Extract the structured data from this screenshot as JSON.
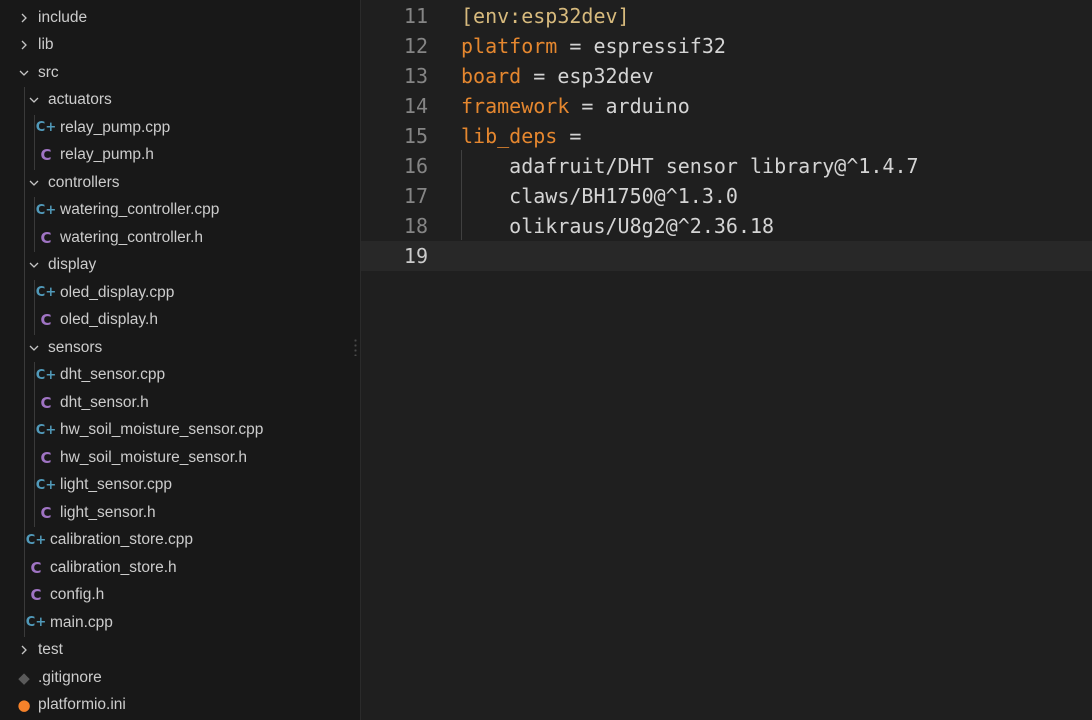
{
  "explorer": {
    "items": [
      {
        "name": "include",
        "kind": "folder",
        "expanded": false,
        "depth": 0
      },
      {
        "name": "lib",
        "kind": "folder",
        "expanded": false,
        "depth": 0
      },
      {
        "name": "src",
        "kind": "folder",
        "expanded": true,
        "depth": 0
      },
      {
        "name": "actuators",
        "kind": "folder",
        "expanded": true,
        "depth": 1
      },
      {
        "name": "relay_pump.cpp",
        "kind": "cpp",
        "depth": 2
      },
      {
        "name": "relay_pump.h",
        "kind": "h",
        "depth": 2
      },
      {
        "name": "controllers",
        "kind": "folder",
        "expanded": true,
        "depth": 1
      },
      {
        "name": "watering_controller.cpp",
        "kind": "cpp",
        "depth": 2
      },
      {
        "name": "watering_controller.h",
        "kind": "h",
        "depth": 2
      },
      {
        "name": "display",
        "kind": "folder",
        "expanded": true,
        "depth": 1
      },
      {
        "name": "oled_display.cpp",
        "kind": "cpp",
        "depth": 2
      },
      {
        "name": "oled_display.h",
        "kind": "h",
        "depth": 2
      },
      {
        "name": "sensors",
        "kind": "folder",
        "expanded": true,
        "depth": 1
      },
      {
        "name": "dht_sensor.cpp",
        "kind": "cpp",
        "depth": 2
      },
      {
        "name": "dht_sensor.h",
        "kind": "h",
        "depth": 2
      },
      {
        "name": "hw_soil_moisture_sensor.cpp",
        "kind": "cpp",
        "depth": 2
      },
      {
        "name": "hw_soil_moisture_sensor.h",
        "kind": "h",
        "depth": 2
      },
      {
        "name": "light_sensor.cpp",
        "kind": "cpp",
        "depth": 2
      },
      {
        "name": "light_sensor.h",
        "kind": "h",
        "depth": 2
      },
      {
        "name": "calibration_store.cpp",
        "kind": "cpp",
        "depth": 1
      },
      {
        "name": "calibration_store.h",
        "kind": "h",
        "depth": 1
      },
      {
        "name": "config.h",
        "kind": "h",
        "depth": 1
      },
      {
        "name": "main.cpp",
        "kind": "cpp",
        "depth": 1
      },
      {
        "name": "test",
        "kind": "folder",
        "expanded": false,
        "depth": 0
      },
      {
        "name": ".gitignore",
        "kind": "git",
        "depth": 0
      },
      {
        "name": "platformio.ini",
        "kind": "pio",
        "depth": 0
      }
    ]
  },
  "icons": {
    "cpp": "C++ file icon",
    "h": "C header icon",
    "git": "git icon",
    "pio": "platformio icon"
  },
  "editor": {
    "current_line": "19",
    "lines": [
      {
        "number": "11",
        "tokens": [
          {
            "t": "[env:esp32dev]",
            "c": "section"
          }
        ]
      },
      {
        "number": "12",
        "tokens": [
          {
            "t": "platform",
            "c": "key"
          },
          {
            "t": " = ",
            "c": "op"
          },
          {
            "t": "espressif32",
            "c": "val"
          }
        ]
      },
      {
        "number": "13",
        "tokens": [
          {
            "t": "board",
            "c": "key"
          },
          {
            "t": " = ",
            "c": "op"
          },
          {
            "t": "esp32dev",
            "c": "val"
          }
        ]
      },
      {
        "number": "14",
        "tokens": [
          {
            "t": "framework",
            "c": "key"
          },
          {
            "t": " = ",
            "c": "op"
          },
          {
            "t": "arduino",
            "c": "val"
          }
        ]
      },
      {
        "number": "15",
        "tokens": [
          {
            "t": "lib_deps",
            "c": "key"
          },
          {
            "t": " =",
            "c": "op"
          }
        ]
      },
      {
        "number": "16",
        "tokens": [
          {
            "t": "    adafruit/DHT sensor library@^1.4.7",
            "c": "val"
          }
        ]
      },
      {
        "number": "17",
        "tokens": [
          {
            "t": "    claws/BH1750@^1.3.0",
            "c": "val"
          }
        ]
      },
      {
        "number": "18",
        "tokens": [
          {
            "t": "    olikraus/U8g2@^2.36.18",
            "c": "val"
          }
        ]
      },
      {
        "number": "19",
        "tokens": []
      }
    ]
  },
  "colors": {
    "section": "#d7ba7d",
    "key": "#e5872f",
    "value": "#d4d4d4",
    "line_number": "#858585",
    "cpp_icon": "#519aba",
    "h_icon": "#a074c4",
    "pio_icon": "#f5822a"
  }
}
